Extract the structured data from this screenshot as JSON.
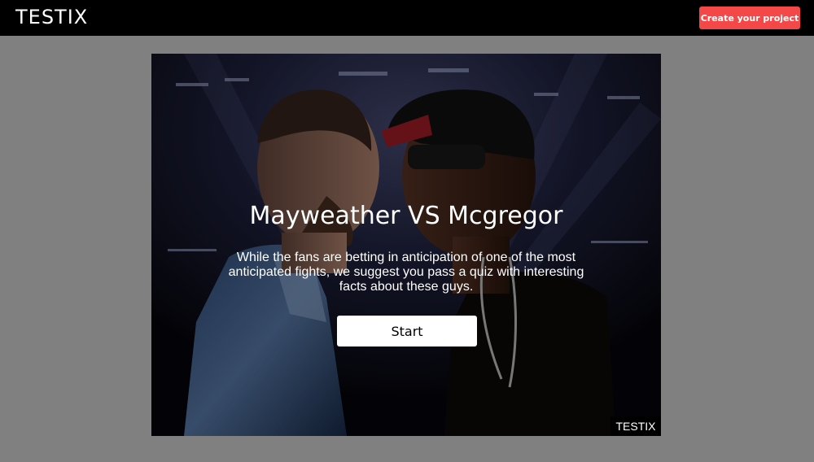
{
  "header": {
    "logo": "TESTIX",
    "cta_label": "Create your project"
  },
  "quiz": {
    "title": "Mayweather VS Mcgregor",
    "description": "While the fans are betting in anticipation of one of the most anticipated fights, we suggest you pass a quiz with interesting facts about these guys.",
    "start_label": "Start",
    "watermark": "TESTIX"
  },
  "colors": {
    "header_bg": "#000000",
    "page_bg": "#808080",
    "cta_bg": "#f44848",
    "start_bg": "#ffffff"
  }
}
